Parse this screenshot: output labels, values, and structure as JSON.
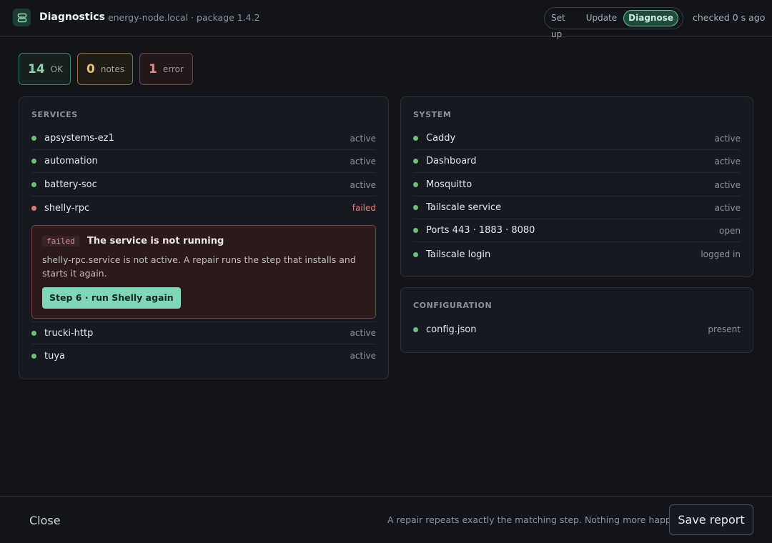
{
  "header": {
    "app_icon": "server-icon",
    "title": "Diagnostics",
    "subtitle": "· energy-node.local · package 1.4.2",
    "modes": [
      "Set up",
      "Update",
      "Diagnose"
    ],
    "active_mode": "Diagnose",
    "checked": "checked 0 s ago"
  },
  "summary": {
    "ok": {
      "count": "14",
      "label": "OK"
    },
    "notes": {
      "count": "0",
      "label": "notes"
    },
    "error": {
      "count": "1",
      "label": "error"
    }
  },
  "services": {
    "title": "SERVICES",
    "items": [
      {
        "name": "apsystems-ez1",
        "status": "active"
      },
      {
        "name": "automation",
        "status": "active"
      },
      {
        "name": "battery-soc",
        "status": "active"
      },
      {
        "name": "shelly-rpc",
        "status": "failed"
      },
      {
        "name": "trucki-http",
        "status": "active"
      },
      {
        "name": "tuya",
        "status": "active"
      }
    ],
    "error": {
      "tag": "failed",
      "title": "The service is not running",
      "description": "shelly-rpc.service is not active. A repair runs the step that installs and starts it again.",
      "action": "Step 6 · run Shelly again"
    }
  },
  "system": {
    "title": "SYSTEM",
    "items": [
      {
        "name": "Caddy",
        "status": "active"
      },
      {
        "name": "Dashboard",
        "status": "active"
      },
      {
        "name": "Mosquitto",
        "status": "active"
      },
      {
        "name": "Tailscale service",
        "status": "active"
      },
      {
        "name": "Ports 443 · 1883 · 8080",
        "status": "open"
      },
      {
        "name": "Tailscale login",
        "status": "logged in"
      }
    ]
  },
  "configuration": {
    "title": "CONFIGURATION",
    "items": [
      {
        "name": "config.json",
        "status": "present"
      }
    ]
  },
  "footer": {
    "close": "Close",
    "note": "A repair repeats exactly the matching step. Nothing more happens.",
    "save": "Save report"
  },
  "colors": {
    "ok": "#6dbd7d",
    "fail": "#d87b7b",
    "accent": "#7fd7b8"
  }
}
